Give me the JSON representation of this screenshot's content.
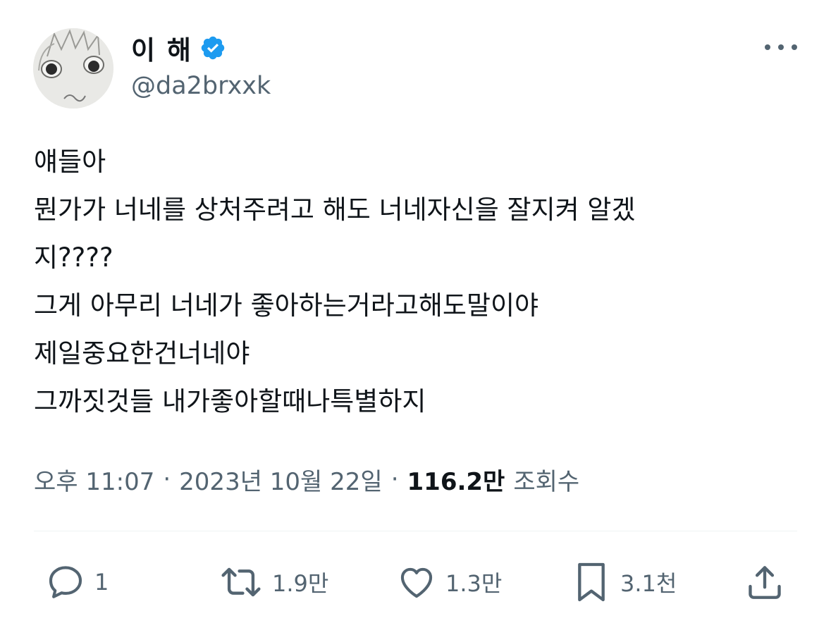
{
  "user": {
    "display_name": "이 해",
    "handle": "@da2brxxk",
    "verified": true,
    "verified_color": "#1d9bf0"
  },
  "tweet": {
    "lines": [
      "얘들아",
      "뭔가가 너네를 상처주려고 해도 너네자신을 잘지켜 알겠",
      "지????",
      "그게 아무리 너네가 좋아하는거라고해도말이야",
      "제일중요한건너네야",
      "그까짓것들 내가좋아할때나특별하지"
    ]
  },
  "meta": {
    "time": "오후 11:07",
    "separator": "·",
    "date": "2023년 10월 22일",
    "views_count": "116.2만",
    "views_label": "조회수"
  },
  "actions": {
    "reply_count": "1",
    "retweet_count": "1.9만",
    "like_count": "1.3만",
    "bookmark_count": "3.1천"
  },
  "icons": {
    "more": "more-horizontal-icon",
    "reply": "reply-icon",
    "retweet": "retweet-icon",
    "like": "heart-icon",
    "bookmark": "bookmark-icon",
    "share": "share-icon"
  },
  "colors": {
    "text": "#0f1419",
    "secondary": "#536471",
    "divider": "#eff3f4"
  }
}
